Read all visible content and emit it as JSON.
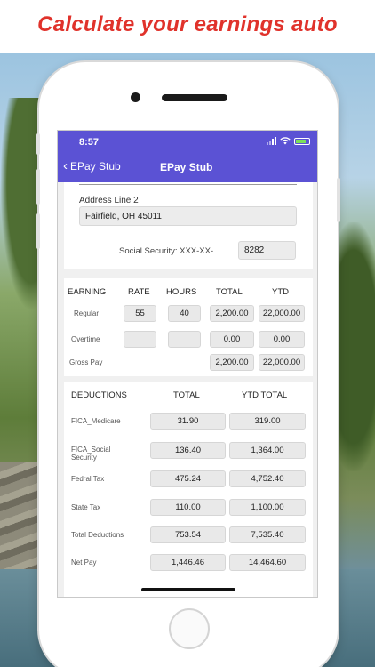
{
  "headline": "Calculate your earnings auto",
  "status_bar": {
    "time": "8:57"
  },
  "nav": {
    "back_label": "EPay Stub",
    "title": "EPay Stub"
  },
  "address": {
    "line2_label": "Address Line 2",
    "line2_value": "Fairfield, OH 45011",
    "ssn_label": "Social Security:  XXX-XX-",
    "ssn_value": "8282"
  },
  "earnings": {
    "headers": {
      "earning": "EARNING",
      "rate": "RATE",
      "hours": "HOURS",
      "total": "TOTAL",
      "ytd": "YTD"
    },
    "rows": [
      {
        "label": "Regular",
        "rate": "55",
        "hours": "40",
        "total": "2,200.00",
        "ytd": "22,000.00"
      },
      {
        "label": "Overtime",
        "rate": "",
        "hours": "",
        "total": "0.00",
        "ytd": "0.00"
      },
      {
        "label": "Gross Pay",
        "total": "2,200.00",
        "ytd": "22,000.00"
      }
    ]
  },
  "deductions": {
    "headers": {
      "deductions": "DEDUCTIONS",
      "total": "TOTAL",
      "ytd_total": "YTD TOTAL"
    },
    "rows": [
      {
        "label": "FICA_Medicare",
        "total": "31.90",
        "ytd": "319.00"
      },
      {
        "label": "FICA_Social Security",
        "total": "136.40",
        "ytd": "1,364.00"
      },
      {
        "label": "Fedral Tax",
        "total": "475.24",
        "ytd": "4,752.40"
      },
      {
        "label": "State Tax",
        "total": "110.00",
        "ytd": "1,100.00"
      },
      {
        "label": "Total Deductions",
        "total": "753.54",
        "ytd": "7,535.40"
      },
      {
        "label": "Net Pay",
        "total": "1,446.46",
        "ytd": "14,464.60"
      }
    ]
  },
  "colors": {
    "navbar": "#5b52d4",
    "headline": "#e0322b"
  }
}
